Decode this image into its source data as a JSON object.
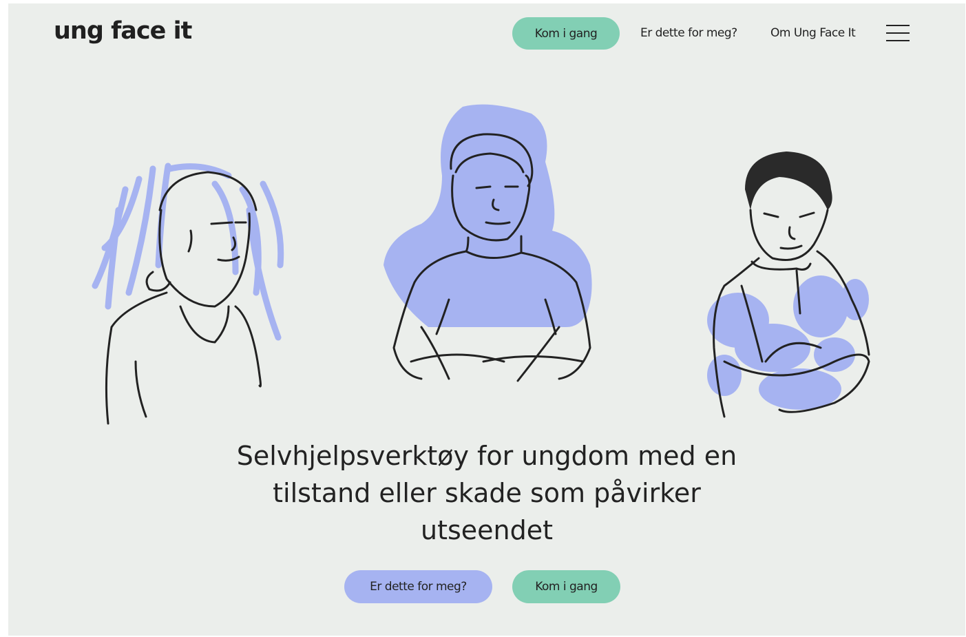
{
  "brand": {
    "logo": "ung face it"
  },
  "nav": {
    "cta": "Kom i gang",
    "links": [
      "Er dette for meg?",
      "Om Ung Face It"
    ]
  },
  "hero": {
    "headline": [
      "Selvhjelpsverktøy for ungdom med en",
      "tilstand eller skade som påvirker",
      "utseendet"
    ],
    "buttons": {
      "primary": "Er dette for meg?",
      "secondary": "Kom i gang"
    }
  },
  "colors": {
    "background": "#ebeeeb",
    "accent_green": "#82cfb4",
    "accent_blue": "#a6b3f1",
    "text": "#222222"
  },
  "icons": {
    "menu": "hamburger-menu-icon"
  }
}
